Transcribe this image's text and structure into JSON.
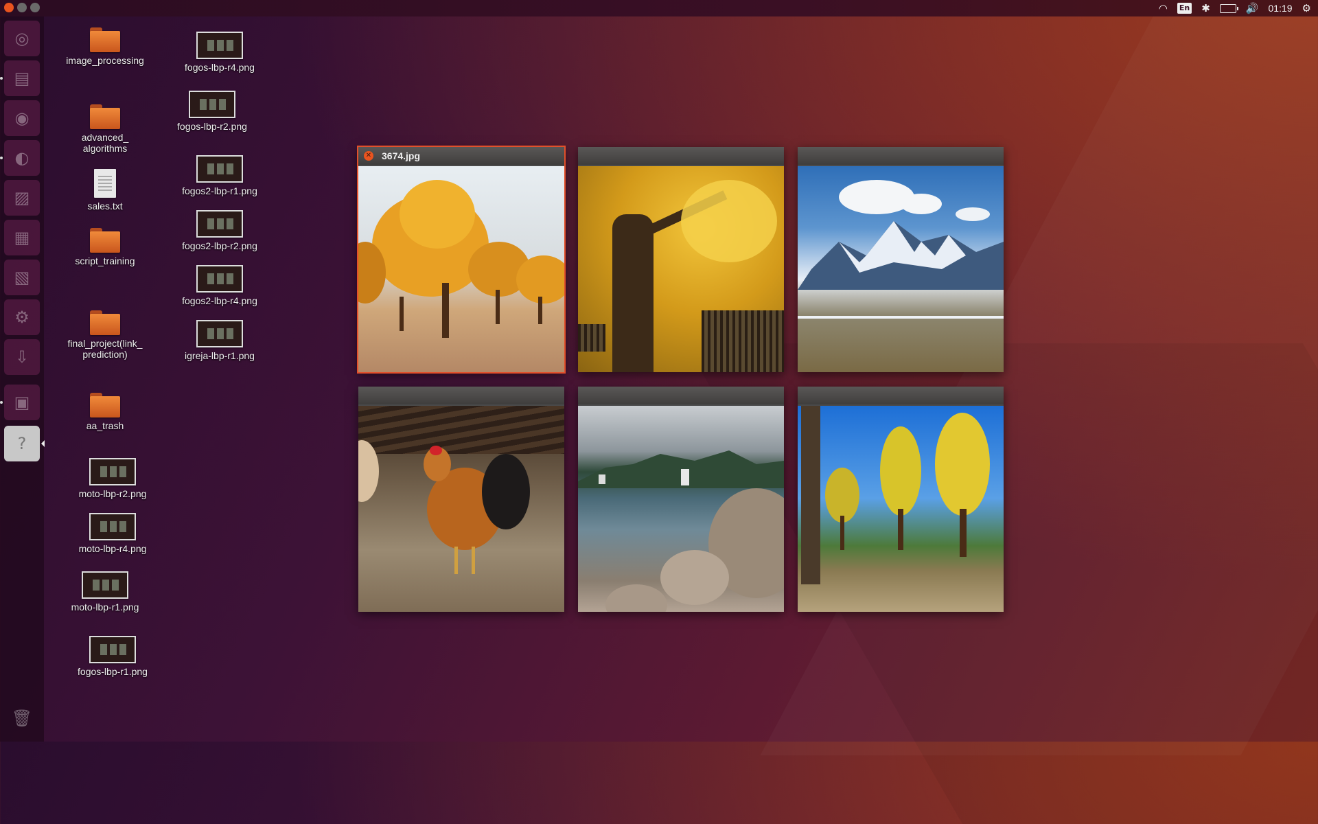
{
  "top_panel": {
    "indicators": {
      "wifi_icon": "wifi-icon",
      "keyboard_layout": "En",
      "bluetooth_icon": "bluetooth-icon",
      "battery_icon": "battery-icon",
      "volume_icon": "volume-icon",
      "clock": "01:19",
      "settings_icon": "gear-icon"
    }
  },
  "launcher": {
    "items": [
      "ubuntu-dash",
      "files",
      "chrome",
      "firefox",
      "libreoffice-writer",
      "libreoffice-calc",
      "libreoffice-impress",
      "system-settings",
      "software-updater",
      "image-viewer",
      "help"
    ],
    "trash_icon": "trash-icon",
    "active_item": "help"
  },
  "desktop": {
    "icons": [
      {
        "label": "image_processing",
        "type": "folder"
      },
      {
        "label": "advanced_\nalgorithms",
        "type": "folder"
      },
      {
        "label": "sales.txt",
        "type": "text-file"
      },
      {
        "label": "script_training",
        "type": "folder"
      },
      {
        "label": "final_project(link_\nprediction)",
        "type": "folder"
      },
      {
        "label": "aa_trash",
        "type": "folder"
      },
      {
        "label": "moto-lbp-r2.png",
        "type": "image"
      },
      {
        "label": "moto-lbp-r4.png",
        "type": "image"
      },
      {
        "label": "moto-lbp-r1.png",
        "type": "image"
      },
      {
        "label": "fogos-lbp-r1.png",
        "type": "image"
      },
      {
        "label": "fogos-lbp-r4.png",
        "type": "image"
      },
      {
        "label": "fogos-lbp-r2.png",
        "type": "image"
      },
      {
        "label": "fogos2-lbp-r1.png",
        "type": "image"
      },
      {
        "label": "fogos2-lbp-r2.png",
        "type": "image"
      },
      {
        "label": "fogos2-lbp-r4.png",
        "type": "image"
      },
      {
        "label": "igreja-lbp-r1.png",
        "type": "image"
      }
    ]
  },
  "spread": {
    "windows": [
      {
        "title": "3674.jpg",
        "selected": true,
        "content": "desert poplar trees photo"
      },
      {
        "title": "",
        "selected": false,
        "content": "ginkgo tree photo"
      },
      {
        "title": "",
        "selected": false,
        "content": "snowy mountains photo"
      },
      {
        "title": "",
        "selected": false,
        "content": "rooster photo"
      },
      {
        "title": "",
        "selected": false,
        "content": "rocky coast photo"
      },
      {
        "title": "",
        "selected": false,
        "content": "ginkgo park photo"
      }
    ]
  },
  "colors": {
    "accent": "#e9541f",
    "panel": "#2b0c22",
    "launcher": "#1e081a"
  }
}
